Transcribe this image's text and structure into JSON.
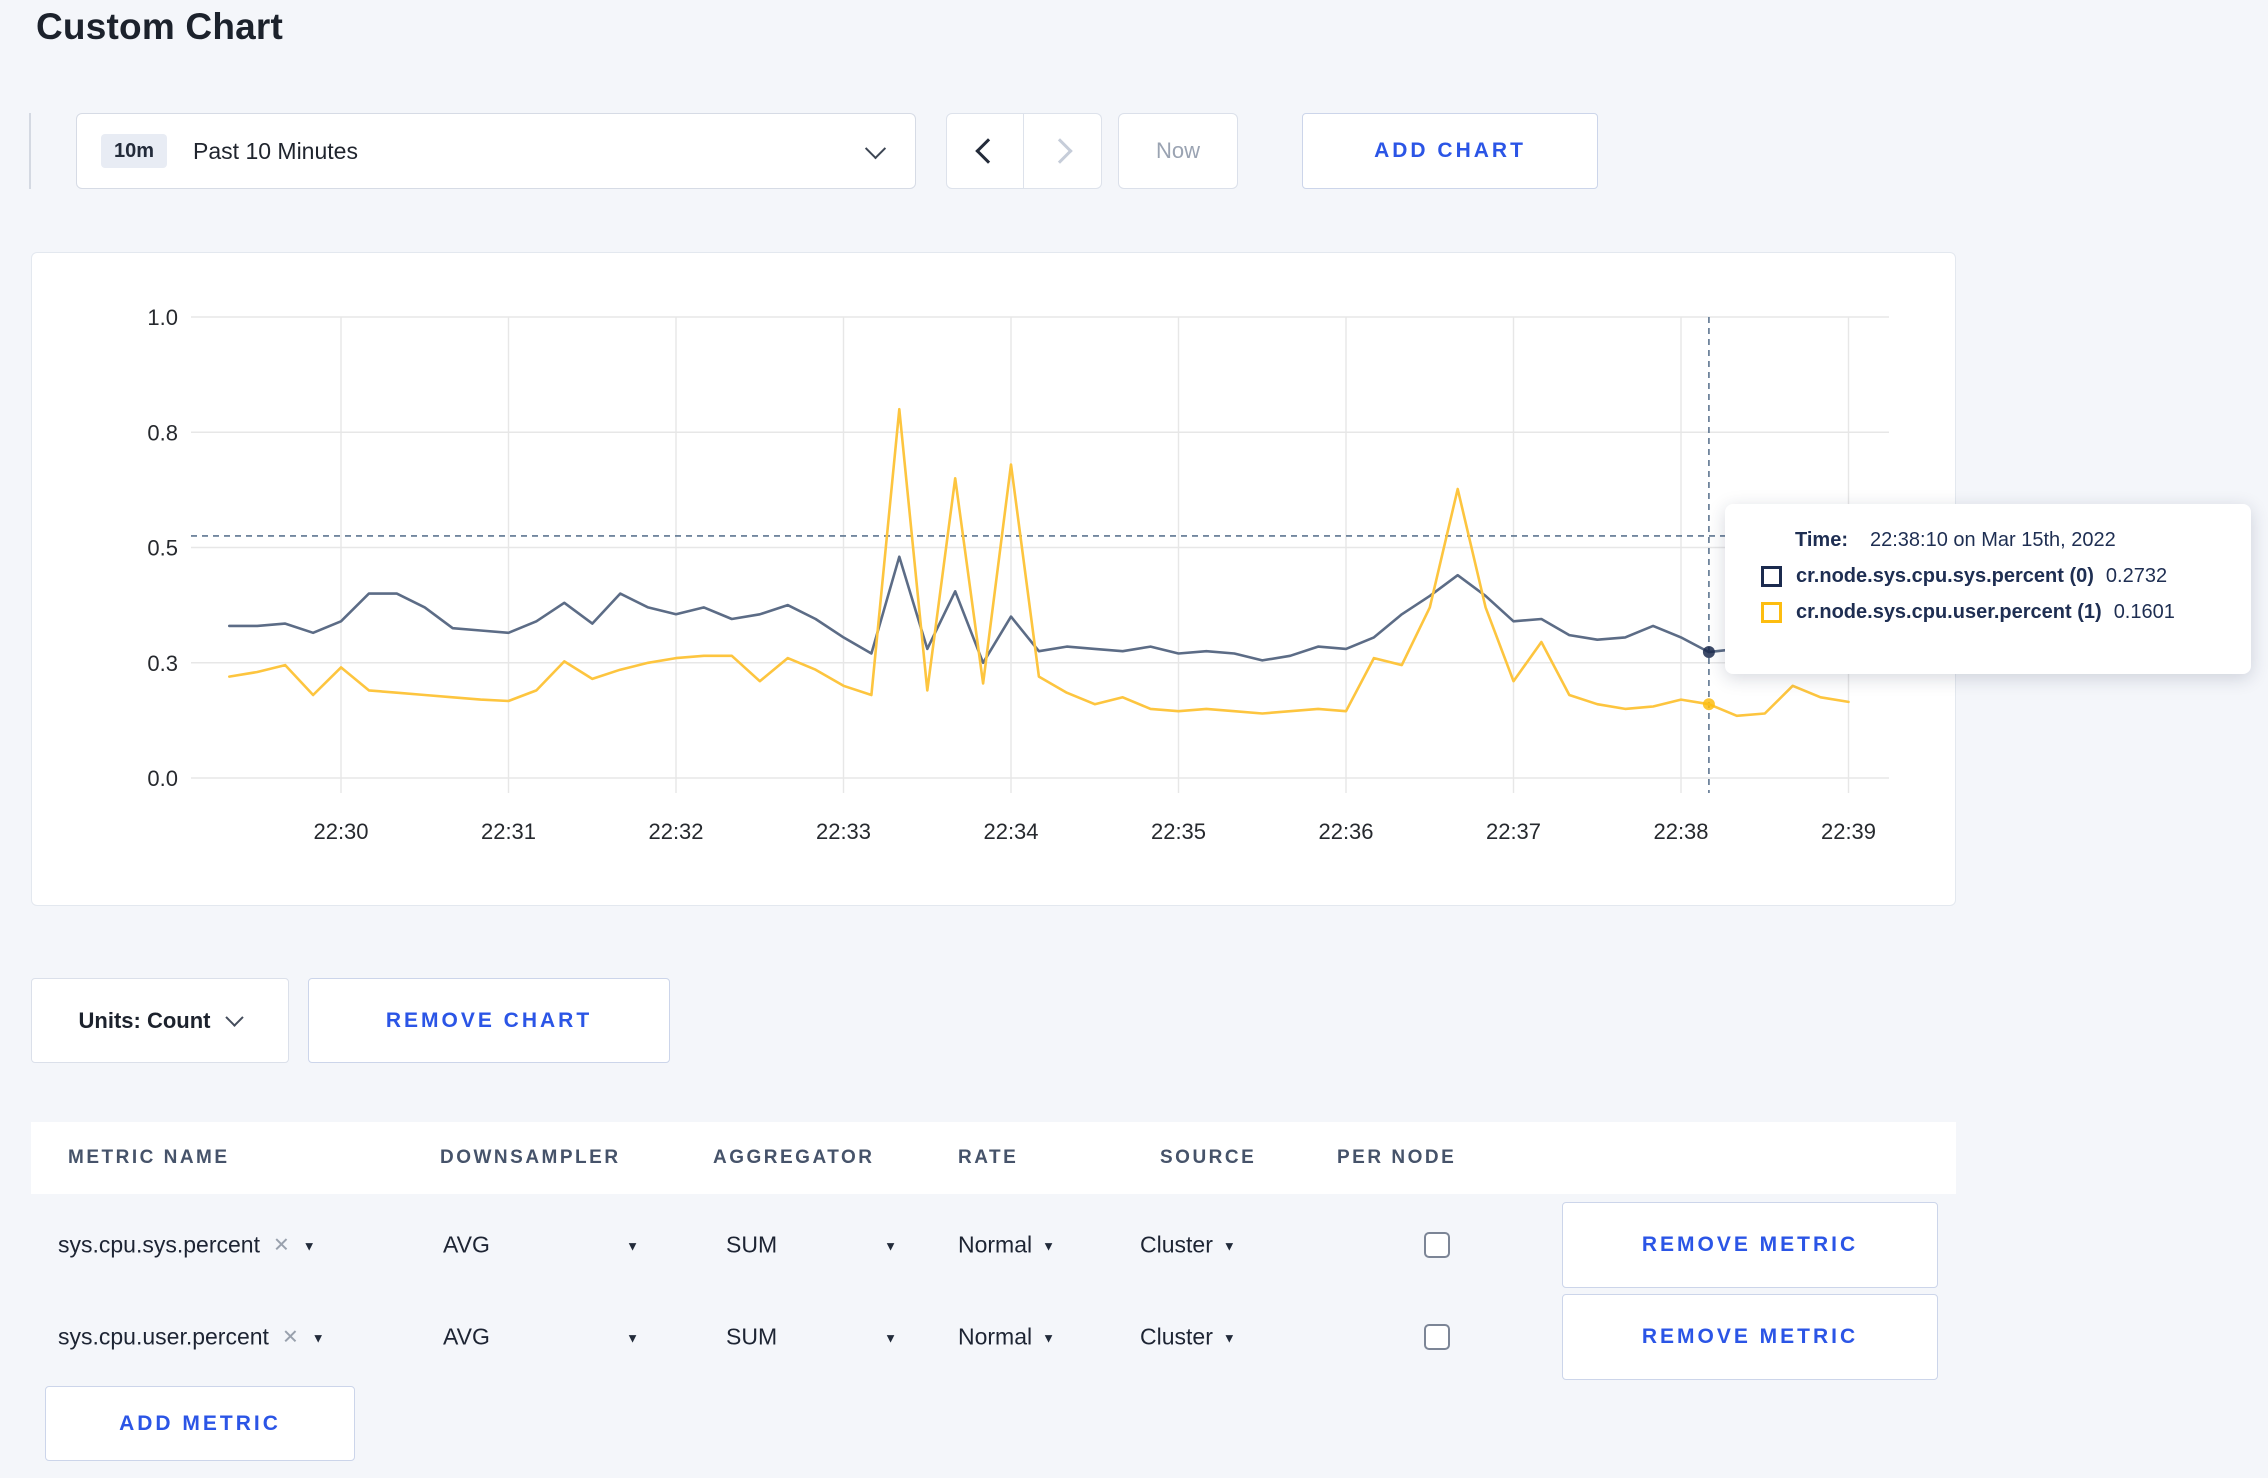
{
  "page": {
    "title": "Custom Chart",
    "background": "#f4f6fa",
    "accent_blue": "#2b55e6"
  },
  "toolbar": {
    "time_range": {
      "badge": "10m",
      "label": "Past 10 Minutes"
    },
    "now_label": "Now",
    "add_chart_label": "ADD CHART"
  },
  "chart_data": {
    "type": "line",
    "title": "",
    "xlabel": "",
    "ylabel": "",
    "grid": true,
    "legend_position": "tooltip",
    "ylim": [
      0,
      1
    ],
    "y_axis": {
      "tick_labels": [
        "0.0",
        "0.3",
        "0.5",
        "0.8",
        "1.0"
      ],
      "tick_values": [
        0,
        0.25,
        0.5,
        0.75,
        1
      ]
    },
    "x_axis": {
      "tick_labels": [
        "22:30",
        "22:31",
        "22:32",
        "22:33",
        "22:34",
        "22:35",
        "22:36",
        "22:37",
        "22:38",
        "22:39"
      ],
      "tick_seconds": [
        60,
        120,
        180,
        240,
        300,
        360,
        420,
        480,
        540,
        600
      ]
    },
    "sampling": {
      "start_time": "22:29:20",
      "start_seconds": 20,
      "step_seconds": 10
    },
    "series": [
      {
        "name": "cr.node.sys.cpu.sys.percent (0)",
        "line_color": "#5c6c86",
        "swatch_color": "#1b2a4e",
        "values": [
          0.33,
          0.33,
          0.335,
          0.315,
          0.34,
          0.4,
          0.4,
          0.37,
          0.325,
          0.32,
          0.315,
          0.34,
          0.38,
          0.335,
          0.4,
          0.37,
          0.355,
          0.37,
          0.345,
          0.355,
          0.375,
          0.345,
          0.305,
          0.27,
          0.48,
          0.28,
          0.405,
          0.25,
          0.35,
          0.275,
          0.285,
          0.28,
          0.275,
          0.285,
          0.27,
          0.275,
          0.27,
          0.255,
          0.265,
          0.285,
          0.28,
          0.305,
          0.355,
          0.395,
          0.44,
          0.395,
          0.34,
          0.345,
          0.31,
          0.3,
          0.305,
          0.33,
          0.305,
          0.2732,
          0.28,
          0.285,
          0.275,
          0.29,
          0.28
        ]
      },
      {
        "name": "cr.node.sys.cpu.user.percent (1)",
        "line_color": "#fdc53f",
        "swatch_color": "#fdbd10",
        "values": [
          0.22,
          0.23,
          0.245,
          0.18,
          0.24,
          0.19,
          0.185,
          0.18,
          0.175,
          0.17,
          0.167,
          0.19,
          0.253,
          0.215,
          0.235,
          0.25,
          0.26,
          0.265,
          0.265,
          0.21,
          0.26,
          0.235,
          0.2,
          0.18,
          0.8,
          0.19,
          0.65,
          0.205,
          0.68,
          0.22,
          0.185,
          0.16,
          0.175,
          0.15,
          0.145,
          0.15,
          0.145,
          0.14,
          0.145,
          0.15,
          0.145,
          0.26,
          0.245,
          0.37,
          0.627,
          0.37,
          0.21,
          0.295,
          0.18,
          0.16,
          0.15,
          0.155,
          0.17,
          0.1601,
          0.135,
          0.14,
          0.2,
          0.175,
          0.165
        ]
      }
    ],
    "crosshair": {
      "time": "22:38:10",
      "time_seconds": 550,
      "hover_value": 0.525,
      "point_values": [
        0.2732,
        0.1601
      ],
      "color": "#5d7590"
    }
  },
  "tooltip": {
    "time_label": "Time:",
    "time_value": "22:38:10 on Mar 15th, 2022",
    "rows": [
      {
        "name": "cr.node.sys.cpu.sys.percent (0)",
        "value": "0.2732"
      },
      {
        "name": "cr.node.sys.cpu.user.percent (1)",
        "value": "0.1601"
      }
    ]
  },
  "chart_controls": {
    "units_label": "Units: Count",
    "remove_chart_label": "REMOVE CHART"
  },
  "metrics_table": {
    "headers": [
      "METRIC NAME",
      "DOWNSAMPLER",
      "AGGREGATOR",
      "RATE",
      "SOURCE",
      "PER NODE"
    ],
    "rows": [
      {
        "metric": "sys.cpu.sys.percent",
        "downsampler": "AVG",
        "aggregator": "SUM",
        "rate": "Normal",
        "source": "Cluster",
        "per_node_checked": false,
        "remove_label": "REMOVE METRIC"
      },
      {
        "metric": "sys.cpu.user.percent",
        "downsampler": "AVG",
        "aggregator": "SUM",
        "rate": "Normal",
        "source": "Cluster",
        "per_node_checked": false,
        "remove_label": "REMOVE METRIC"
      }
    ],
    "add_metric_label": "ADD METRIC"
  },
  "icons": {
    "caret_down": "▼",
    "close": "✕"
  }
}
